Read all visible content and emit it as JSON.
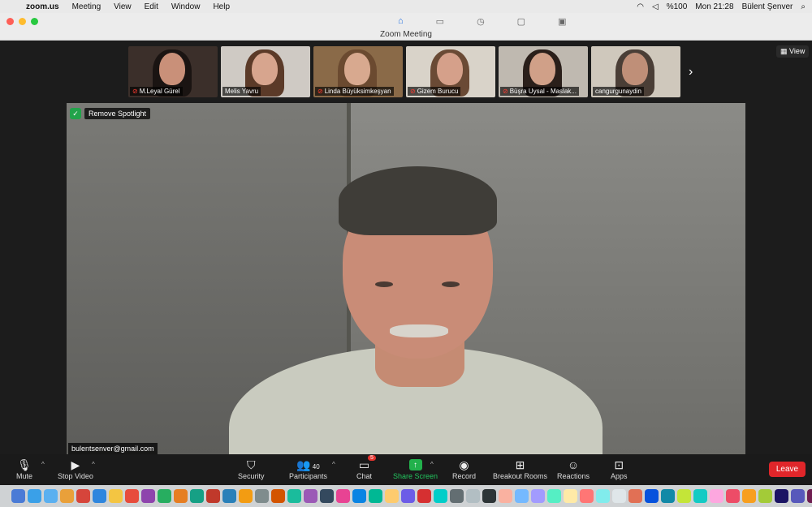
{
  "menubar": {
    "app": "zoom.us",
    "items": [
      "Meeting",
      "View",
      "Edit",
      "Window",
      "Help"
    ],
    "battery": "%100",
    "clock": "Mon 21:28",
    "user": "Bülent Şenver"
  },
  "window": {
    "title": "Zoom Meeting"
  },
  "view_button": "View",
  "participants_strip": [
    {
      "name": "M.Leyal Gürel",
      "muted": true,
      "bg": "#3b2f2a",
      "skin": "#c99079",
      "hair": "#1a1412"
    },
    {
      "name": "Melis Yavru",
      "muted": false,
      "bg": "#cfcac4",
      "skin": "#d7a58e",
      "hair": "#5b3a28"
    },
    {
      "name": "Linda Büyüksimkeşyan",
      "muted": true,
      "bg": "#8a6a48",
      "skin": "#d8a98f",
      "hair": "#6b4a30"
    },
    {
      "name": "Gizem Burucu",
      "muted": true,
      "bg": "#d9d3c9",
      "skin": "#d5a08a",
      "hair": "#6a4a35"
    },
    {
      "name": "Büşra Uysal - Maslak...",
      "muted": true,
      "bg": "#bfb9b0",
      "skin": "#d0a088",
      "hair": "#2a1f1a"
    },
    {
      "name": "cangurgunaydin",
      "muted": false,
      "bg": "#cfc8bc",
      "skin": "#bf8f78",
      "hair": "#4a3e36"
    }
  ],
  "spotlight": {
    "remove_label": "Remove Spotlight",
    "speaker_name": "bulentsenver@gmail.com"
  },
  "toolbar": {
    "mute": "Mute",
    "stop_video": "Stop Video",
    "security": "Security",
    "participants": "Participants",
    "participants_count": "40",
    "chat": "Chat",
    "chat_badge": "5",
    "share_screen": "Share Screen",
    "record": "Record",
    "breakout": "Breakout Rooms",
    "reactions": "Reactions",
    "apps": "Apps",
    "leave": "Leave"
  },
  "dock_colors": [
    "#4a7bd6",
    "#3aa0e8",
    "#5ab0f0",
    "#e9a03a",
    "#d6453b",
    "#2e86de",
    "#f4c542",
    "#e74c3c",
    "#8e44ad",
    "#27ae60",
    "#e67e22",
    "#16a085",
    "#c0392b",
    "#2980b9",
    "#f39c12",
    "#7f8c8d",
    "#d35400",
    "#1abc9c",
    "#9b59b6",
    "#34495e",
    "#e84393",
    "#0984e3",
    "#00b894",
    "#fdcb6e",
    "#6c5ce7",
    "#d63031",
    "#00cec9",
    "#636e72",
    "#b2bec3",
    "#2d3436",
    "#fab1a0",
    "#74b9ff",
    "#a29bfe",
    "#55efc4",
    "#ffeaa7",
    "#ff7675",
    "#81ecec",
    "#dfe6e9",
    "#e17055",
    "#0652dd",
    "#1289a7",
    "#c4e538",
    "#12cbc4",
    "#fda7df",
    "#ed4c67",
    "#f79f1f",
    "#a3cb38",
    "#1b1464",
    "#5758bb",
    "#6f1e51",
    "#833471",
    "#ea2027",
    "#006266",
    "#9980fa",
    "#d980fa",
    "#b53471",
    "#ee5a24",
    "#009432"
  ]
}
